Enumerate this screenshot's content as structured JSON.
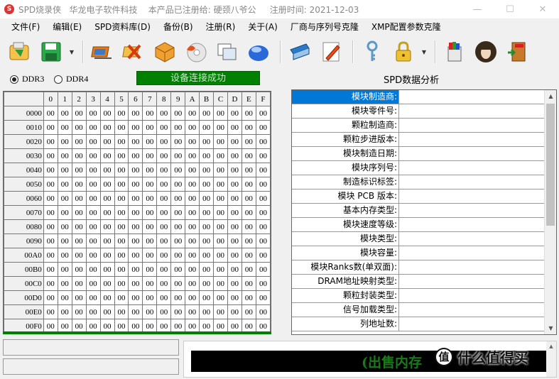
{
  "window": {
    "app_icon_letter": "S",
    "title": "SPD烧录侠   华龙电子软件科技    本产品已注册给: 硬颈八爷公     注册时间: 2021-12-03",
    "min_glyph": "—",
    "max_glyph": "☐",
    "close_glyph": "✕"
  },
  "menu": [
    "文件(F)",
    "编辑(E)",
    "SPD资料库(D)",
    "备份(B)",
    "注册(R)",
    "关于(A)",
    "厂商与序列号克隆",
    "XMP配置参数克隆"
  ],
  "toolbar": {
    "dropdown_glyph": "▼",
    "icons": [
      "open-icon",
      "save-icon",
      "chip-icon",
      "erase-icon",
      "package-icon",
      "burn-disc-icon",
      "compare-windows-icon",
      "sphere-icon",
      "write-board-icon",
      "edit-pencil-icon",
      "key-icon",
      "lock-icon",
      "paint-bucket-icon",
      "avatar-icon",
      "exit-icon"
    ]
  },
  "mode": {
    "ddr3_label": "DDR3",
    "ddr4_label": "DDR4",
    "selected": "DDR3",
    "status": "设备连接成功",
    "spd_title": "SPD数据分析"
  },
  "hex": {
    "columns": [
      "0",
      "1",
      "2",
      "3",
      "4",
      "5",
      "6",
      "7",
      "8",
      "9",
      "A",
      "B",
      "C",
      "D",
      "E",
      "F"
    ],
    "rows": [
      "0000",
      "0010",
      "0020",
      "0030",
      "0040",
      "0050",
      "0060",
      "0070",
      "0080",
      "0090",
      "00A0",
      "00B0",
      "00C0",
      "00D0",
      "00E0",
      "00F0"
    ],
    "cell_value": "00"
  },
  "spd_fields": [
    "模块制造商:",
    "模块零件号:",
    "颗粒制造商:",
    "颗粒步进版本:",
    "模块制造日期:",
    "模块序列号:",
    "制造标识标签:",
    "模块 PCB 版本:",
    "基本内存类型:",
    "模块速度等级:",
    "模块类型:",
    "模块容量:",
    "模块Ranks数(单双面):",
    "DRAM地址映射类型:",
    "颗粒封装类型:",
    "信号加载类型:",
    "列地址数:"
  ],
  "spd_selected_index": 0,
  "scroll": {
    "up": "▲",
    "down": "▼"
  },
  "ticker": {
    "text": "(出售内存"
  },
  "watermark": {
    "logo": "值",
    "text": "什么值得买"
  },
  "colors": {
    "status_green": "#008000",
    "selection_blue": "#0078d7",
    "ticker_green": "#1a7a1a"
  }
}
